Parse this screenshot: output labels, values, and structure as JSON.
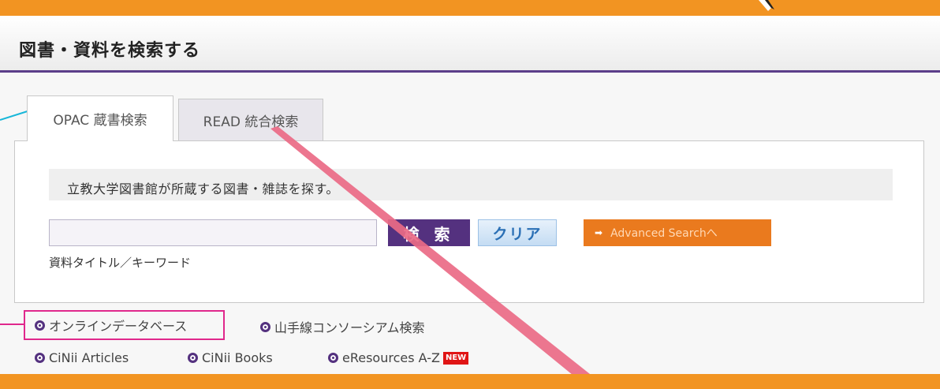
{
  "header": {
    "title": "図書・資料を検索する"
  },
  "tabs": [
    {
      "label": "OPAC 蔵書検索",
      "active": true
    },
    {
      "label": "READ 統合検索",
      "active": false
    }
  ],
  "search": {
    "description": "立教大学図書館が所蔵する図書・雑誌を探す。",
    "input_value": "",
    "input_placeholder": "",
    "hint": "資料タイトル／キーワード",
    "search_label": "検 索",
    "clear_label": "クリア",
    "advanced_label": "Advanced Searchへ"
  },
  "links": {
    "online_db": "オンラインデータベース",
    "yamate": "山手線コンソーシアム検索",
    "cinii_articles": "CiNii Articles",
    "cinii_books": "CiNii Books",
    "eresources": "eResources A-Z",
    "new_badge": "NEW"
  },
  "colors": {
    "accent_orange": "#f29422",
    "brand_purple": "#54317f",
    "callout_cyan": "#18b7d9",
    "callout_magenta": "#e0288c",
    "callout_pink": "#ea6a86"
  }
}
